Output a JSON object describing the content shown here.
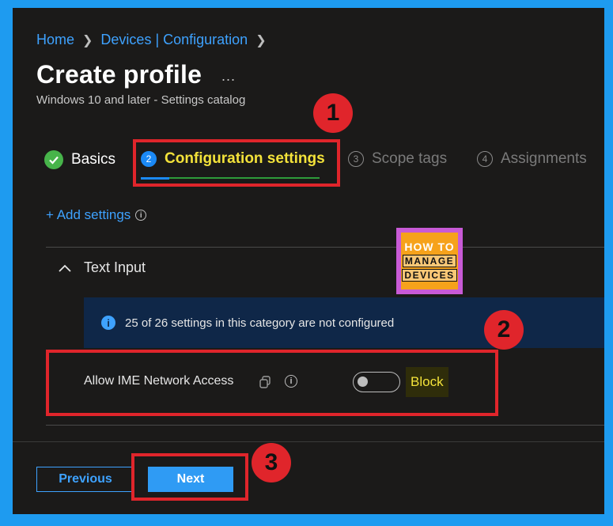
{
  "breadcrumb": {
    "items": [
      "Home",
      "Devices | Configuration"
    ]
  },
  "page": {
    "title": "Create profile",
    "more": "...",
    "subtitle": "Windows 10 and later - Settings catalog"
  },
  "tabs": [
    {
      "label": "Basics",
      "state": "completed"
    },
    {
      "number": "2",
      "label": "Configuration settings",
      "state": "active"
    },
    {
      "number": "3",
      "label": "Scope tags",
      "state": "inactive"
    },
    {
      "number": "4",
      "label": "Assignments",
      "state": "inactive"
    }
  ],
  "add_settings": {
    "label": "+ Add settings",
    "icon": "info-icon"
  },
  "section": {
    "title": "Text Input",
    "icon": "chevron-up-icon"
  },
  "banner": {
    "text": "25 of 26 settings in this category are not configured",
    "icon": "info-icon"
  },
  "setting": {
    "label": "Allow IME Network Access",
    "copy_icon": "copy-icon",
    "info_icon": "info-icon",
    "toggle_on": false,
    "value_label": "Block"
  },
  "footer": {
    "previous_label": "Previous",
    "next_label": "Next"
  },
  "annotations": [
    "1",
    "2",
    "3"
  ],
  "logo": {
    "line1": "HOW TO",
    "line2": "MANAGE",
    "line3": "DEVICES"
  },
  "colors": {
    "accent": "#3ea2ff",
    "highlight": "#f3e23a",
    "annotation": "#e0252b",
    "background": "#1b1a19"
  }
}
